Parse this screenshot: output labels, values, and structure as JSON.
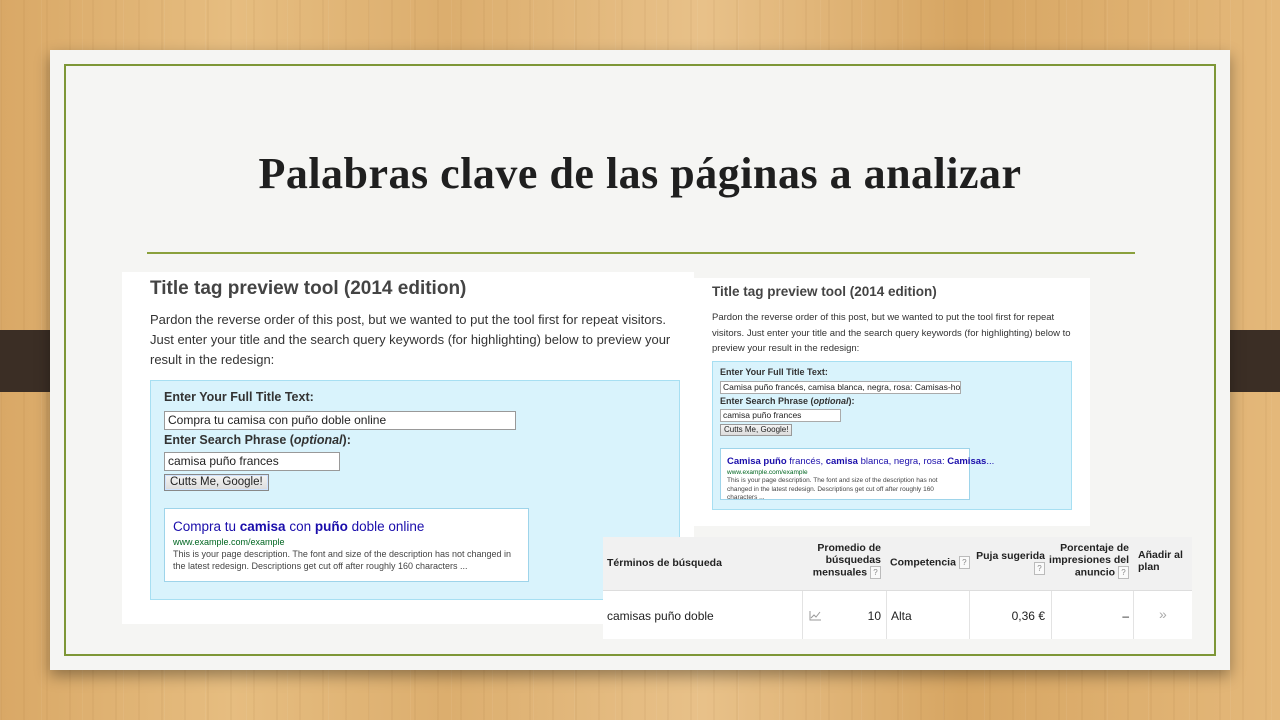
{
  "slide": {
    "title": "Palabras clave de las páginas a analizar"
  },
  "left_tool": {
    "heading": "Title tag preview tool (2014 edition)",
    "intro": "Pardon the reverse order of this post, but we wanted to put the tool first for repeat visitors. Just enter your title and the search query keywords (for highlighting) below to preview your result in the redesign:",
    "title_label": "Enter Your Full Title Text:",
    "title_value": "Compra tu camisa con puño doble online",
    "phrase_label_pre": "Enter Search Phrase (",
    "phrase_label_em": "optional",
    "phrase_label_post": "):",
    "phrase_value": "camisa puño frances",
    "button_label": "Cutts Me, Google!",
    "serp": {
      "title_parts": [
        "Compra tu ",
        "camisa",
        " con ",
        "puño",
        " doble online"
      ],
      "url": "www.example.com/example",
      "description": "This is your page description. The font and size of the description has not changed in the latest redesign. Descriptions get cut off after roughly 160 characters ..."
    }
  },
  "right_tool": {
    "heading": "Title tag preview tool (2014 edition)",
    "intro": "Pardon the reverse order of this post, but we wanted to put the tool first for repeat visitors. Just enter your title and the search query keywords (for highlighting) below to preview your result in the redesign:",
    "title_label": "Enter Your Full Title Text:",
    "title_value": "Camisa puño francés, camisa blanca, negra, rosa: Camisas-hombre",
    "phrase_label_pre": "Enter Search Phrase (",
    "phrase_label_em": "optional",
    "phrase_label_post": "):",
    "phrase_value": "camisa puño frances",
    "button_label": "Cutts Me, Google!",
    "serp": {
      "title_parts": [
        "Camisa puño",
        " francés, ",
        "camisa",
        " blanca, negra, rosa: ",
        "Camisas",
        "..."
      ],
      "url": "www.example.com/example",
      "description": "This is your page description. The font and size of the description has not changed in the latest redesign. Descriptions get cut off after roughly 160 characters ..."
    }
  },
  "keyword_table": {
    "headers": {
      "term": "Términos de búsqueda",
      "avg_l1": "Promedio de",
      "avg_l2": "búsquedas",
      "avg_l3": "mensuales",
      "competition": "Competencia",
      "bid": "Puja sugerida",
      "impr_l1": "Porcentaje de",
      "impr_l2": "impresiones del",
      "impr_l3": "anuncio",
      "add_l1": "Añadir al",
      "add_l2": "plan"
    },
    "help_glyph": "?",
    "rows": [
      {
        "term": "camisas puño doble",
        "searches": "10",
        "competition": "Alta",
        "bid": "0,36 €",
        "impression_share": "–",
        "add_glyph": "»"
      }
    ]
  }
}
